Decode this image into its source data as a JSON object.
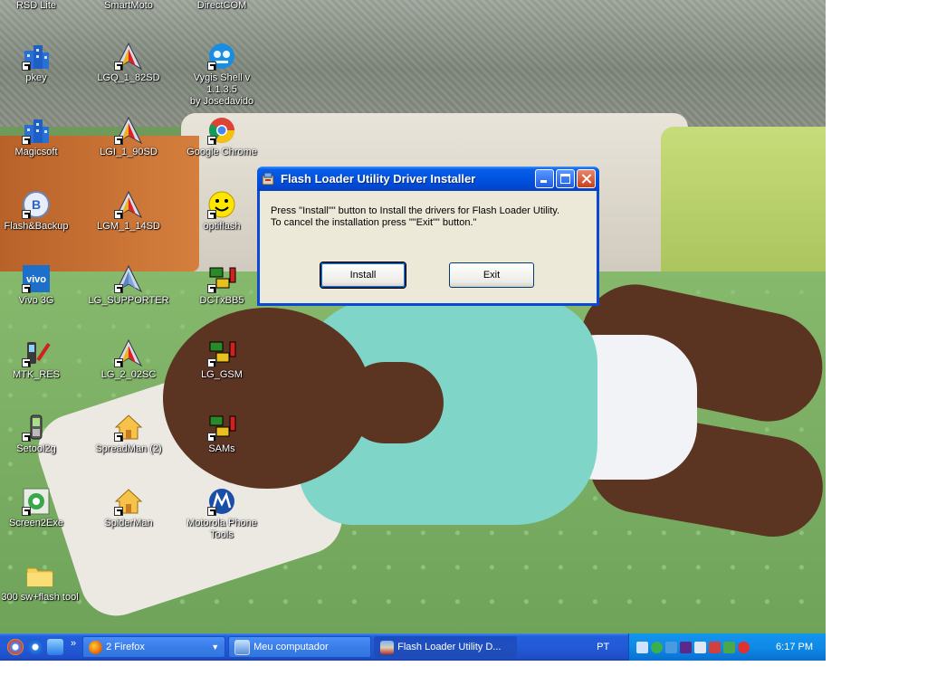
{
  "desktop": {
    "icons": [
      {
        "label": "RSD Lite",
        "icon": "rsd-lite-icon"
      },
      {
        "label": "SmartMoto",
        "icon": "smartmoto-icon"
      },
      {
        "label": "DirectCOM",
        "icon": "directcom-icon"
      },
      {
        "label": "pkey",
        "icon": "building-icon"
      },
      {
        "label": "LGQ_1_82SD",
        "icon": "lg-tool-icon"
      },
      {
        "label": "Vygis Shell v 1.1.3.5",
        "label2": "by Josedavido",
        "icon": "vygis-shell-icon"
      },
      {
        "label": "Magicsoft",
        "icon": "building-icon"
      },
      {
        "label": "LGI_1_90SD",
        "icon": "lg-tool-icon"
      },
      {
        "label": "Google Chrome",
        "icon": "chrome-icon"
      },
      {
        "label": "Flash&Backup",
        "icon": "flash-backup-icon"
      },
      {
        "label": "LGM_1_14SD",
        "icon": "lg-tool-icon"
      },
      {
        "label": "optiflash",
        "icon": "smiley-icon"
      },
      {
        "label": "Vivo 3G",
        "icon": "vivo-icon"
      },
      {
        "label": "LG_SUPPORTER",
        "icon": "lg-supporter-icon"
      },
      {
        "label": "DCTxBB5",
        "icon": "network-phone-icon"
      },
      {
        "label": "MTK_RES",
        "icon": "phone-pen-icon"
      },
      {
        "label": "LG_2_02SC",
        "icon": "lg-tool-icon"
      },
      {
        "label": "LG_GSM",
        "icon": "network-phone-icon"
      },
      {
        "label": "Setool2g",
        "icon": "mobile-phone-icon"
      },
      {
        "label": "SpreadMan (2)",
        "icon": "house-icon"
      },
      {
        "label": "SAMs",
        "icon": "network-phone-icon"
      },
      {
        "label": "Screen2Exe",
        "icon": "screen2exe-icon"
      },
      {
        "label": "SpiderMan",
        "icon": "house-icon"
      },
      {
        "label": "Motorola Phone",
        "label2": "Tools",
        "icon": "motorola-icon"
      },
      {
        "label": "300 sw+flash tool",
        "icon": "folder-icon"
      }
    ]
  },
  "dialog": {
    "title": "Flash Loader Utility Driver Installer",
    "message_line1": "Press \"Install\"\" button to Install the drivers for Flash Loader Utility.",
    "message_line2": "To cancel the installation press \"\"Exit\"\" button.\"",
    "install_label": "Install",
    "exit_label": "Exit"
  },
  "taskbar": {
    "tasks": [
      {
        "label": "2 Firefox",
        "icon": "firefox-icon"
      },
      {
        "label": "Meu computador",
        "icon": "my-computer-icon"
      },
      {
        "label": "Flash Loader Utility D...",
        "icon": "installer-icon"
      }
    ],
    "language": "PT",
    "clock": "6:17 PM"
  },
  "colors": {
    "taskbar_blue": "#245edb",
    "tray_blue": "#0e8ae8",
    "titlebar_blue": "#0053e1",
    "dialog_face": "#ece9d8",
    "close_red": "#c9401c"
  }
}
